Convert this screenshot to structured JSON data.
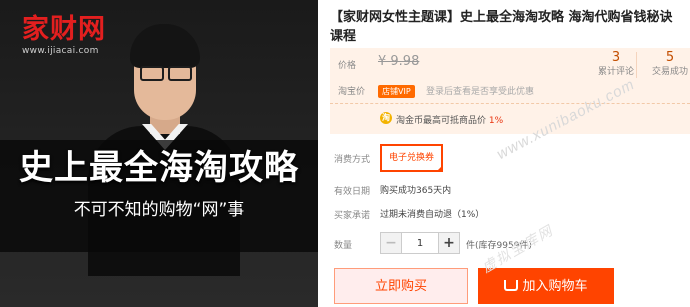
{
  "image": {
    "logo_text": "家财网",
    "logo_url": "www.ijiacai.com",
    "headline": "史上最全海淘攻略",
    "subline": "不可不知的购物“网”事"
  },
  "product": {
    "title": "【家财网女性主题课】史上最全海淘攻略 海淘代购省钱秘诀课程"
  },
  "price_box": {
    "price_label": "价格",
    "price_value": "¥ 9.98",
    "reviews_value": "3",
    "reviews_label": "累计评论",
    "sales_value": "5",
    "sales_label": "交易成功",
    "member_label": "淘宝价",
    "vip_badge": "店铺VIP",
    "member_note": "登录后查看是否享受此优惠",
    "coin_icon_glyph": "淘",
    "promo_prefix": "淘金币最高可抵商品价",
    "promo_percent": "1%"
  },
  "specs": {
    "option_label": "消费方式",
    "option_value": "电子兑换券",
    "validity_label": "有效日期",
    "validity_value": "购买成功365天内",
    "refund_label": "买家承诺",
    "refund_value": "过期未消费自动退（1%）",
    "qty_label": "数量",
    "qty_minus": "−",
    "qty_value": "1",
    "qty_plus": "+",
    "stock_text": "件(库存9959件)"
  },
  "actions": {
    "buy_now": "立即购买",
    "add_to_cart": "加入购物车"
  },
  "watermarks": {
    "url": "www.xunibaoku.com",
    "site": "虚拟宝库网"
  },
  "colors": {
    "accent": "#ff4400",
    "price_bg": "#fff2e8",
    "logo_red": "#e31f1f"
  }
}
